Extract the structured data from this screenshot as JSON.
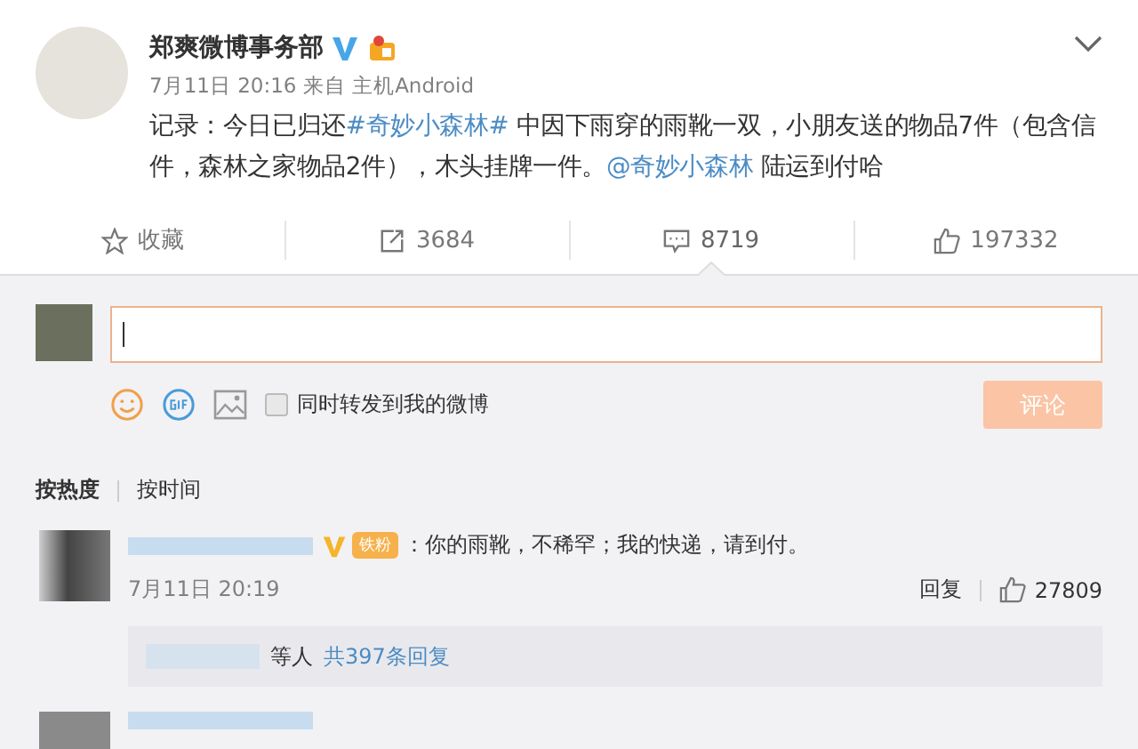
{
  "post": {
    "author": "郑爽微博事务部",
    "time": "7月11日 20:16",
    "source_prefix": "来自",
    "source": "主机Android",
    "text": [
      "记录：今日已归还",
      "#奇妙小森林#",
      " 中因下雨穿的雨靴一双，小朋友送的物品7件（包含信件，森林之家物品2件），木头挂牌一件。",
      "@奇妙小森林",
      " 陆运到付哈"
    ]
  },
  "actions": [
    {
      "kind": "favorite",
      "label": "收藏",
      "selected": false
    },
    {
      "kind": "repost",
      "label": "3684",
      "selected": false
    },
    {
      "kind": "comment",
      "label": "8719",
      "selected": true
    },
    {
      "kind": "like",
      "label": "197332",
      "selected": false
    }
  ],
  "composer": {
    "forward_label": "同时转发到我的微博",
    "forward_checked": false,
    "submit": "评论"
  },
  "sort_tabs": [
    {
      "label": "按热度",
      "selected": true
    },
    {
      "label": "按时间",
      "selected": false
    }
  ],
  "comments": [
    {
      "badge": "铁粉",
      "text": "：你的雨靴，不稀罕；我的快递，请到付。",
      "time": "7月11日 20:19",
      "reply": "回复",
      "likes": "27809",
      "replies_suffix": "等人",
      "replies_link": "共397条回复"
    }
  ]
}
